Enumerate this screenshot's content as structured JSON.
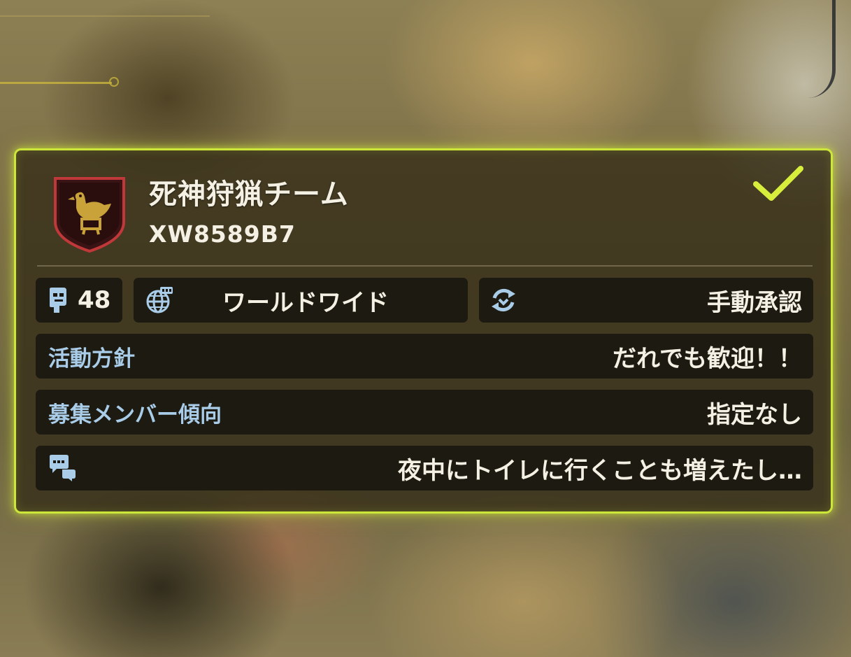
{
  "team": {
    "name": "死神狩猟チーム",
    "id": "XW8589B7",
    "emblem_icon": "chocobo-shield-emblem-icon",
    "selected": true
  },
  "stats": {
    "members": "48",
    "region": "ワールドワイド",
    "approval": "手動承認"
  },
  "details": {
    "policy_label": "活動方針",
    "policy_value": "だれでも歓迎！！",
    "recruit_label": "募集メンバー傾向",
    "recruit_value": "指定なし",
    "message_value": "夜中にトイレに行くことも増えたし…"
  },
  "colors": {
    "frame": "#cde63a",
    "label": "#a9cde8",
    "text": "#f4f0e4",
    "emblem": "#c9a23a"
  }
}
